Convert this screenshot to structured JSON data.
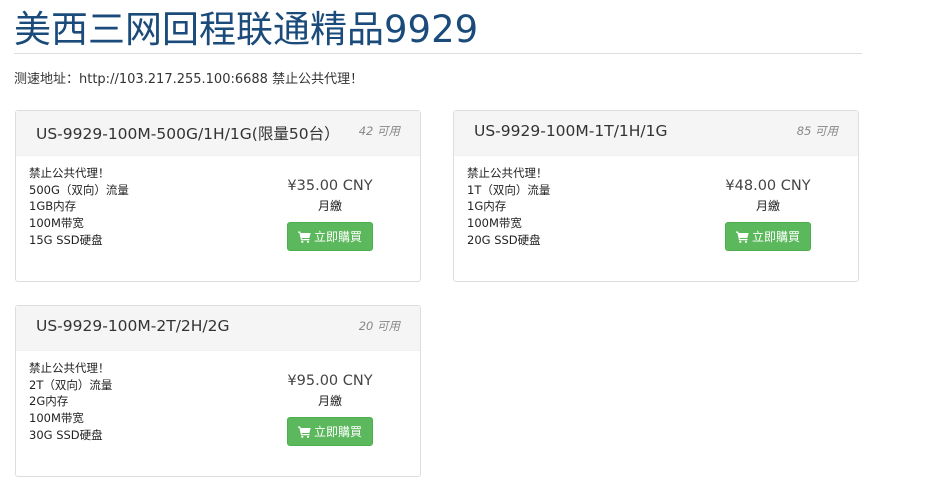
{
  "header": {
    "title": "美西三网回程联通精品9929",
    "speedtest_text": "测速地址：http://103.217.255.100:6688 禁止公共代理！"
  },
  "colors": {
    "title": "#1a4b7a",
    "buy_button": "#5cb85c",
    "card_header": "#f5f5f5"
  },
  "products": [
    {
      "name": "US-9929-100M-500G/1H/1G(限量50台）",
      "qty": "42 可用",
      "features": [
        "禁止公共代理！",
        "500G（双向）流量",
        "1GB内存",
        "100M带宽",
        "15G SSD硬盘"
      ],
      "price": "¥35.00 CNY",
      "cycle": "月繳",
      "buy_label": "立即購買",
      "buy_icon": "shopping-cart-icon"
    },
    {
      "name": "US-9929-100M-1T/1H/1G",
      "qty": "85 可用",
      "features": [
        "禁止公共代理！",
        "1T（双向）流量",
        "1G内存",
        "100M带宽",
        "20G SSD硬盘"
      ],
      "price": "¥48.00 CNY",
      "cycle": "月繳",
      "buy_label": "立即購買",
      "buy_icon": "shopping-cart-icon"
    },
    {
      "name": "US-9929-100M-2T/2H/2G",
      "qty": "20 可用",
      "features": [
        "禁止公共代理！",
        "2T（双向）流量",
        "2G内存",
        "100M带宽",
        "30G SSD硬盘"
      ],
      "price": "¥95.00 CNY",
      "cycle": "月繳",
      "buy_label": "立即購買",
      "buy_icon": "shopping-cart-icon"
    }
  ]
}
